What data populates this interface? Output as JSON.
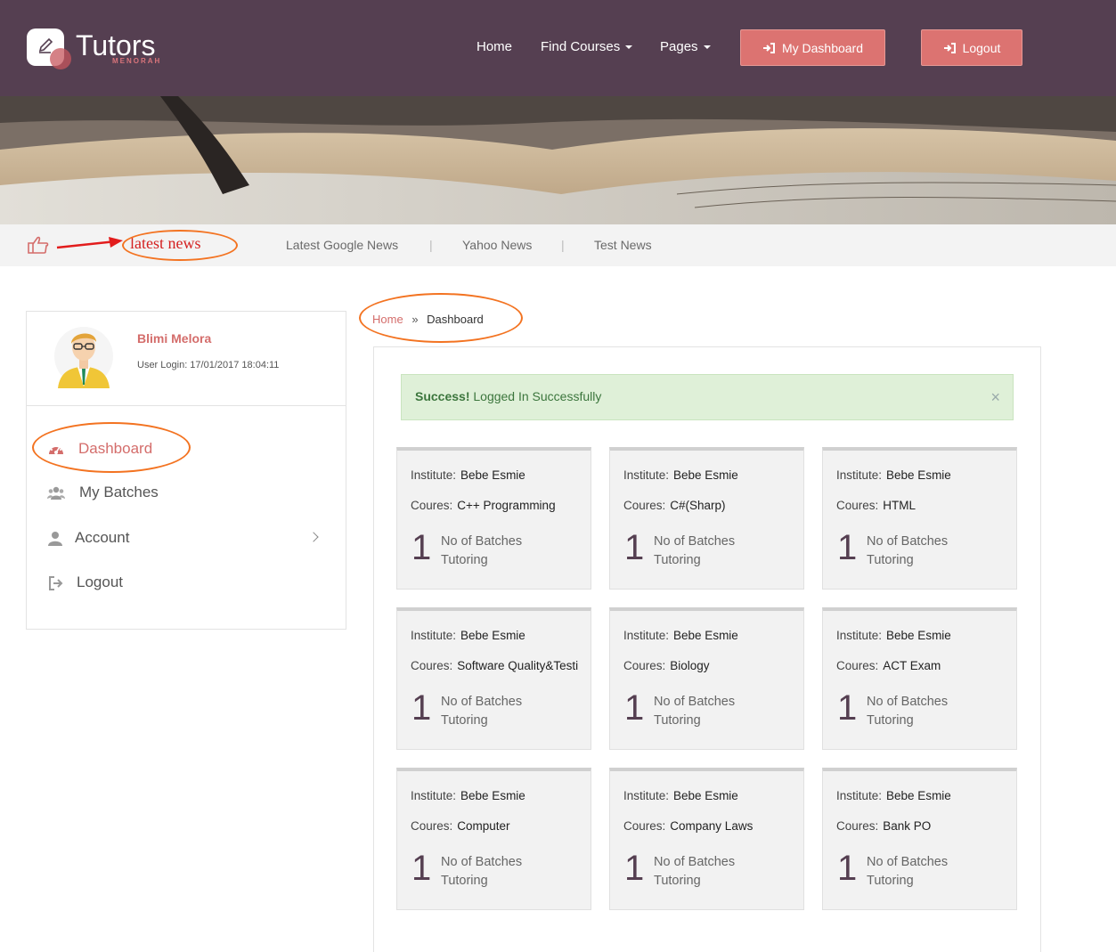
{
  "brand": {
    "name": "Tutors",
    "subtitle": "MENORAH"
  },
  "nav": {
    "home": "Home",
    "find_courses": "Find Courses",
    "pages": "Pages",
    "my_dashboard": "My Dashboard",
    "logout": "Logout"
  },
  "news": {
    "label": "latest news",
    "links": [
      "Latest Google News",
      "Yahoo News",
      "Test News"
    ],
    "separator": "|"
  },
  "profile": {
    "name": "Blimi Melora",
    "last_login": "User Login: 17/01/2017 18:04:11"
  },
  "sidebar": {
    "items": [
      {
        "label": "Dashboard",
        "icon": "dashboard-icon"
      },
      {
        "label": "My Batches",
        "icon": "users-icon"
      },
      {
        "label": "Account",
        "icon": "user-icon"
      },
      {
        "label": "Logout",
        "icon": "sign-out-icon"
      }
    ]
  },
  "breadcrumb": {
    "home": "Home",
    "separator": "»",
    "current": "Dashboard"
  },
  "alert": {
    "strong": "Success!",
    "message": "Logged In Successfully",
    "close": "×"
  },
  "card_labels": {
    "institute": "Institute:",
    "course": "Coures:",
    "batches": "No of Batches",
    "tutoring": "Tutoring"
  },
  "courses": [
    {
      "institute": "Bebe Esmie",
      "course": "C++ Programming",
      "count": "1"
    },
    {
      "institute": "Bebe Esmie",
      "course": "C#(Sharp)",
      "count": "1"
    },
    {
      "institute": "Bebe Esmie",
      "course": "HTML",
      "count": "1"
    },
    {
      "institute": "Bebe Esmie",
      "course": "Software Quality&Testing",
      "count": "1"
    },
    {
      "institute": "Bebe Esmie",
      "course": "Biology",
      "count": "1"
    },
    {
      "institute": "Bebe Esmie",
      "course": "ACT Exam",
      "count": "1"
    },
    {
      "institute": "Bebe Esmie",
      "course": "Computer",
      "count": "1"
    },
    {
      "institute": "Bebe Esmie",
      "course": "Company Laws",
      "count": "1"
    },
    {
      "institute": "Bebe Esmie",
      "course": "Bank PO",
      "count": "1"
    }
  ],
  "colors": {
    "header": "#553f51",
    "accent": "#dc7371",
    "annotation_orange": "#f37321",
    "annotation_red": "#e21c1c"
  }
}
